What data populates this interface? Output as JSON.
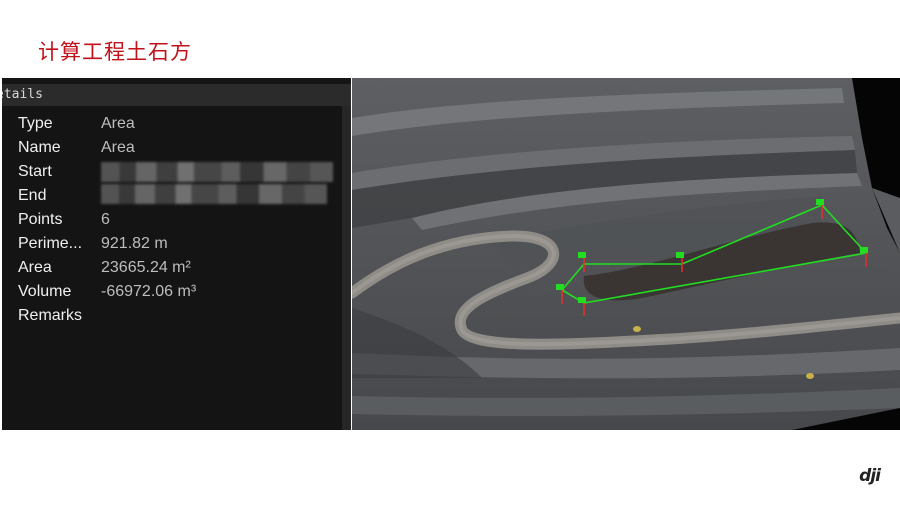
{
  "slide": {
    "title": "计算工程土石方"
  },
  "panel": {
    "header": "etails",
    "rows": [
      {
        "label": "Type",
        "value": "Area"
      },
      {
        "label": "Name",
        "value": "Area"
      },
      {
        "label": "Start",
        "value": ""
      },
      {
        "label": "End",
        "value": ""
      },
      {
        "label": "Points",
        "value": "6"
      },
      {
        "label": "Perime...",
        "value": "921.82 m"
      },
      {
        "label": "Area",
        "value": "23665.24 m²"
      },
      {
        "label": "Volume",
        "value": "-66972.06 m³"
      },
      {
        "label": "Remarks",
        "value": ""
      }
    ]
  },
  "map": {
    "outline_color": "#22dd22",
    "flag_color": "#e0302e",
    "point_count": 6
  },
  "logo": {
    "text": "dji"
  }
}
